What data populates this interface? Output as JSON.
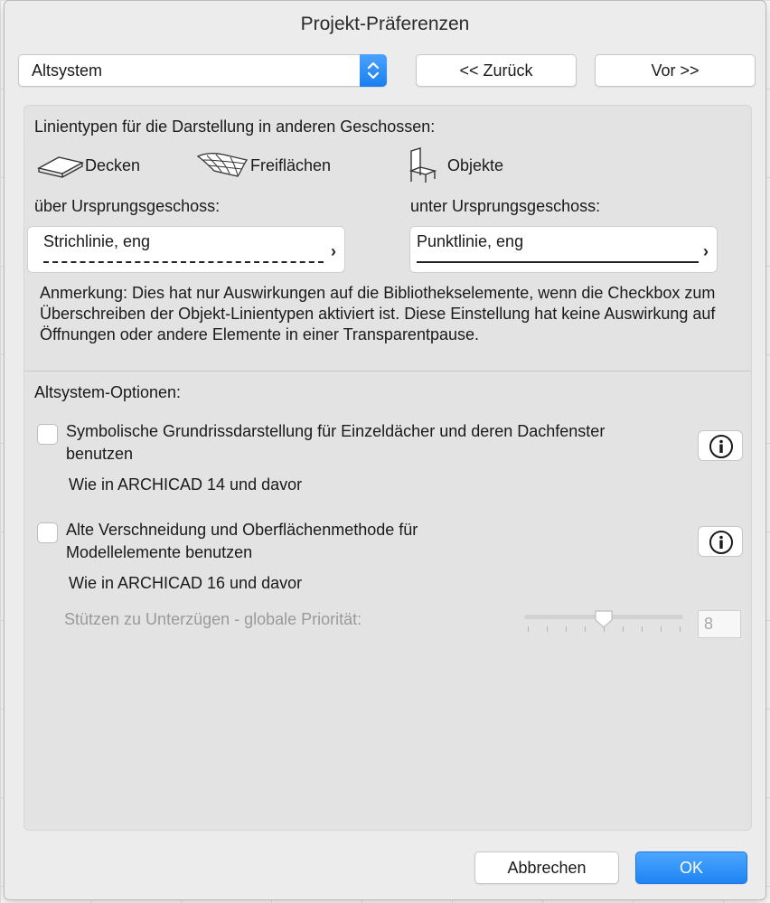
{
  "window": {
    "title": "Projekt-Präferenzen"
  },
  "header": {
    "popup_value": "Altsystem",
    "back_label": "<< Zurück",
    "next_label": "Vor >>"
  },
  "linetypes": {
    "heading": "Linientypen für die Darstellung in anderen Geschossen:",
    "categories": [
      {
        "label": "Decken",
        "icon": "slab-icon"
      },
      {
        "label": "Freiflächen",
        "icon": "mesh-icon"
      },
      {
        "label": "Objekte",
        "icon": "chair-icon"
      }
    ],
    "above": {
      "label": "über Ursprungsgeschoss:",
      "value": "Strichlinie, eng"
    },
    "below": {
      "label": "unter Ursprungsgeschoss:",
      "value": "Punktlinie, eng"
    },
    "note": "Anmerkung: Dies hat nur Auswirkungen auf die Bibliothekselemente, wenn die Checkbox zum Überschreiben der Objekt-Linientypen aktiviert ist. Diese Einstellung hat keine Auswirkung auf Öffnungen oder andere Elemente in einer Transparentpause."
  },
  "legacy": {
    "heading": "Altsystem-Optionen:",
    "options": [
      {
        "label": "Symbolische Grundrissdarstellung für Einzeldächer und deren Dachfenster benutzen",
        "sub": "Wie in ARCHICAD 14 und davor",
        "checked": false
      },
      {
        "label": "Alte Verschneidung und Oberflächenmethode für Modellelemente benutzen",
        "sub": "Wie in ARCHICAD 16 und davor",
        "checked": false
      }
    ],
    "priority": {
      "label": "Stützen zu Unterzügen - globale Priorität:",
      "value": "8"
    }
  },
  "footer": {
    "cancel_label": "Abbrechen",
    "ok_label": "OK"
  },
  "colors": {
    "accent": "#1f83f2",
    "panel": "#e3e3e3",
    "window": "#ececec"
  }
}
